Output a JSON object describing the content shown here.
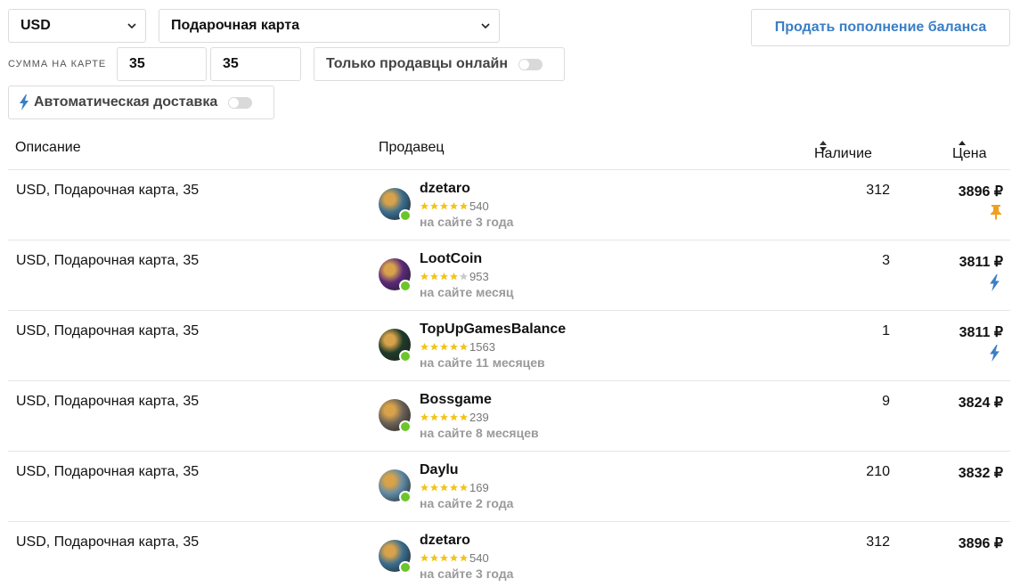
{
  "filters": {
    "currency": "USD",
    "product": "Подарочная карта",
    "sum_label": "СУММА НА КАРТЕ",
    "sum_from": "35",
    "sum_to": "35",
    "online_only_label": "Только продавцы онлайн",
    "auto_delivery_label": "Автоматическая доставка"
  },
  "sell_button": "Продать пополнение баланса",
  "table": {
    "headers": {
      "description": "Описание",
      "seller": "Продавец",
      "stock": "Наличие",
      "price": "Цена"
    },
    "rows": [
      {
        "description": "USD, Подарочная карта, 35",
        "seller": "dzetaro",
        "rating": 5,
        "reviews": "540",
        "since": "на сайте 3 года",
        "stock": "312",
        "price": "3896 ₽",
        "badge": "pin-icon",
        "avatar_color": "#3b6e8f"
      },
      {
        "description": "USD, Подарочная карта, 35",
        "seller": "LootCoin",
        "rating": 4,
        "reviews": "953",
        "since": "на сайте месяц",
        "stock": "3",
        "price": "3811 ₽",
        "badge": "lightning-icon",
        "avatar_color": "#5a2a7a"
      },
      {
        "description": "USD, Подарочная карта, 35",
        "seller": "TopUpGamesBalance",
        "rating": 5,
        "reviews": "1563",
        "since": "на сайте 11 месяцев",
        "stock": "1",
        "price": "3811 ₽",
        "badge": "lightning-icon",
        "avatar_color": "#1f3a2a"
      },
      {
        "description": "USD, Подарочная карта, 35",
        "seller": "Bossgame",
        "rating": 5,
        "reviews": "239",
        "since": "на сайте 8 месяцев",
        "stock": "9",
        "price": "3824 ₽",
        "badge": "",
        "avatar_color": "#6b6258"
      },
      {
        "description": "USD, Подарочная карта, 35",
        "seller": "Daylu",
        "rating": 5,
        "reviews": "169",
        "since": "на сайте 2 года",
        "stock": "210",
        "price": "3832 ₽",
        "badge": "",
        "avatar_color": "#5f8aa6"
      },
      {
        "description": "USD, Подарочная карта, 35",
        "seller": "dzetaro",
        "rating": 5,
        "reviews": "540",
        "since": "на сайте 3 года",
        "stock": "312",
        "price": "3896 ₽",
        "badge": "",
        "avatar_color": "#3b6e8f"
      }
    ]
  },
  "colors": {
    "accent": "#3a7ec6",
    "star": "#f2c318",
    "online": "#6cc52a",
    "pin": "#f0a020"
  }
}
